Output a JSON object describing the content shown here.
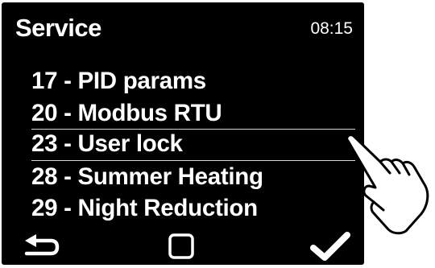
{
  "header": {
    "title": "Service",
    "time": "08:15"
  },
  "menu": {
    "items": [
      {
        "label": "17 - PID params",
        "selected": false
      },
      {
        "label": "20 - Modbus RTU",
        "selected": false
      },
      {
        "label": "23 - User lock",
        "selected": true
      },
      {
        "label": "28 - Summer Heating",
        "selected": false
      },
      {
        "label": "29 - Night Reduction",
        "selected": false
      }
    ]
  },
  "nav": {
    "back_icon": "back-arrow-icon",
    "home_icon": "square-icon",
    "confirm_icon": "checkmark-icon"
  },
  "overlay": {
    "hand_icon": "pointing-hand-icon"
  },
  "colors": {
    "screen_background": "#000000",
    "text": "#ffffff",
    "selection_line": "#d8d8d8"
  }
}
